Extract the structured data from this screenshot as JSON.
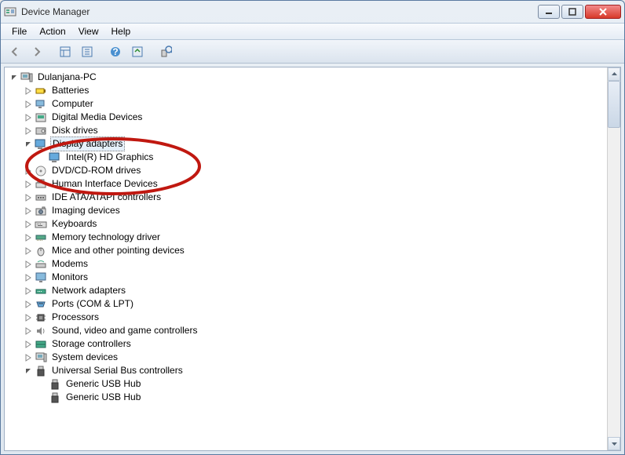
{
  "window": {
    "title": "Device Manager"
  },
  "menu": {
    "file": "File",
    "action": "Action",
    "view": "View",
    "help": "Help"
  },
  "tree": {
    "root": "Dulanjana-PC",
    "batteries": "Batteries",
    "computer": "Computer",
    "digital_media": "Digital Media Devices",
    "disk_drives": "Disk drives",
    "display_adapters": "Display adapters",
    "intel_hd": "Intel(R) HD Graphics",
    "dvd": "DVD/CD-ROM drives",
    "hid": "Human Interface Devices",
    "ide": "IDE ATA/ATAPI controllers",
    "imaging": "Imaging devices",
    "keyboards": "Keyboards",
    "memtech": "Memory technology driver",
    "mice": "Mice and other pointing devices",
    "modems": "Modems",
    "monitors": "Monitors",
    "network": "Network adapters",
    "ports": "Ports (COM & LPT)",
    "processors": "Processors",
    "sound": "Sound, video and game controllers",
    "storage": "Storage controllers",
    "system": "System devices",
    "usb": "Universal Serial Bus controllers",
    "usb_hub1": "Generic USB Hub",
    "usb_hub2": "Generic USB Hub"
  }
}
